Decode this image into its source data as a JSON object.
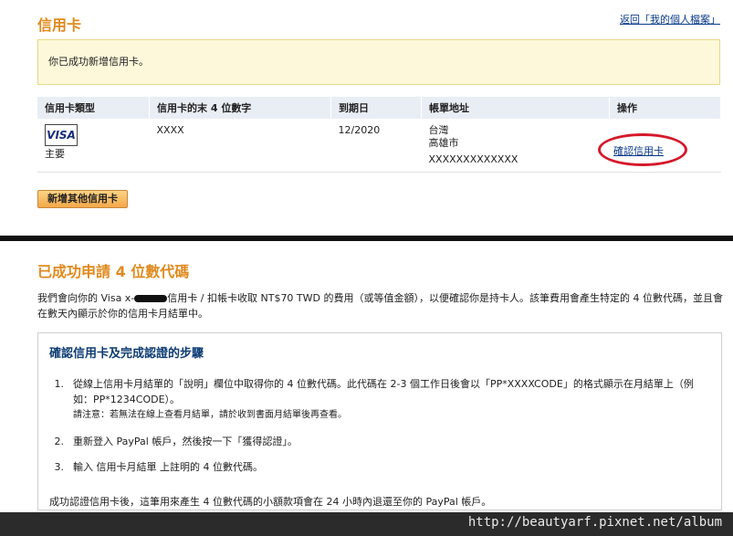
{
  "header": {
    "title": "信用卡",
    "back_link": "返回「我的個人檔案」"
  },
  "notice": {
    "text": "你已成功新增信用卡。"
  },
  "table": {
    "columns": [
      "信用卡類型",
      "信用卡的末 4 位數字",
      "到期日",
      "帳單地址",
      "操作"
    ],
    "row": {
      "card_brand": "VISA",
      "card_role": "主要",
      "last4": "XXXX",
      "expiry": "12/2020",
      "address_line1": "台灣",
      "address_line2": "高雄市",
      "address_line3": "XXXXXXXXXXXXX",
      "action_confirm": "確認信用卡"
    }
  },
  "add_button": "新增其他信用卡",
  "section2": {
    "title": "已成功申請 4 位數代碼",
    "desc_pre": "我們會向你的 Visa x-",
    "desc_post": "信用卡 / 扣帳卡收取 NT$70 TWD 的費用（或等值金額），以便確認你是持卡人。該筆費用會產生特定的 4 位數代碼，並且會在數天內顯示於你的信用卡月結單中。"
  },
  "steps": {
    "title": "確認信用卡及完成認證的步驟",
    "items": [
      {
        "num": "1.",
        "text": "從線上信用卡月結單的「說明」欄位中取得你的 4 位數代碼。此代碼在 2-3 個工作日後會以「PP*XXXXCODE」的格式顯示在月結單上（例如：PP*1234CODE）。",
        "note": "請注意：若無法在線上查看月結單，請於收到書面月結單後再查看。"
      },
      {
        "num": "2.",
        "text": "重新登入 PayPal 帳戶，然後按一下「獲得認證」。"
      },
      {
        "num": "3.",
        "text": "輸入 信用卡月結單 上註明的 4 位數代碼。"
      }
    ],
    "footer": "成功認證信用卡後，這筆用來產生 4 位數代碼的小額款項會在 24 小時內退還至你的 PayPal 帳戶。"
  },
  "watermark": "http://beautyarf.pixnet.net/album"
}
